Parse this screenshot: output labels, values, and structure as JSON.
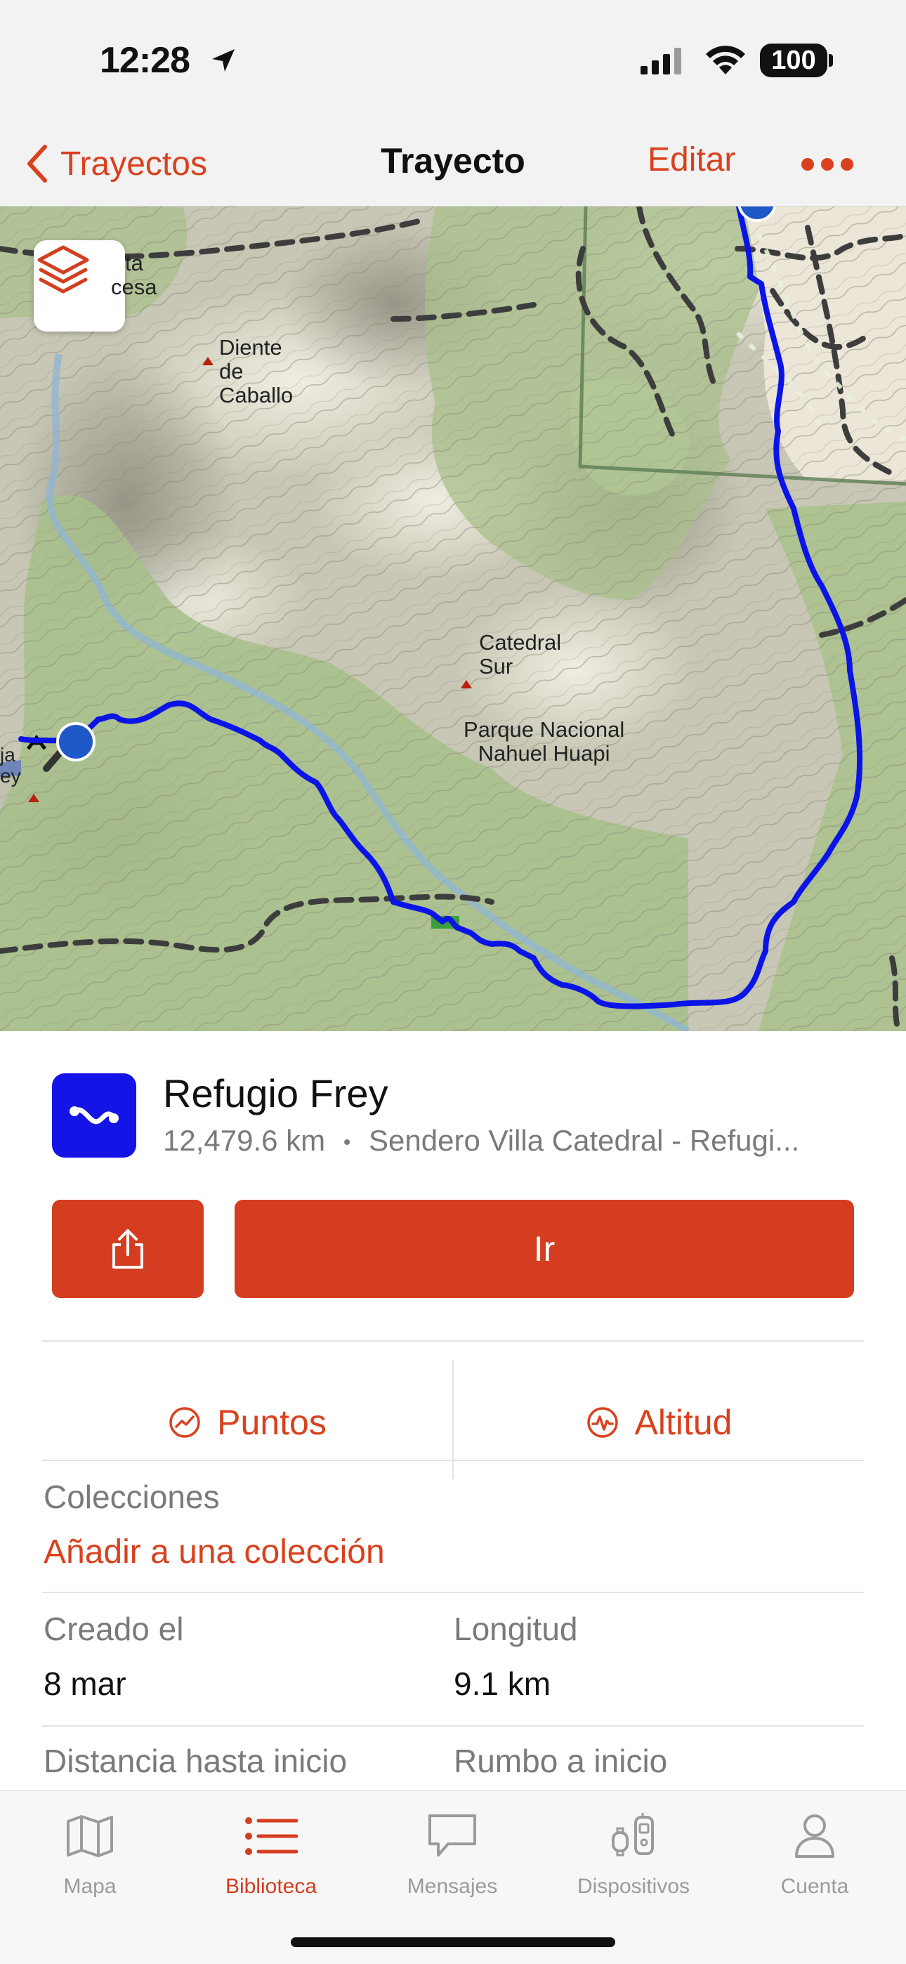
{
  "status": {
    "time": "12:28",
    "battery": "100"
  },
  "nav": {
    "back_label": "Trayectos",
    "title": "Trayecto",
    "edit_label": "Editar"
  },
  "map": {
    "labels": {
      "princesa_a": "ta",
      "princesa_b": "cesa",
      "diente_1": "Diente",
      "diente_2": "de",
      "diente_3": "Caballo",
      "catedral_1": "Catedral",
      "catedral_2": "Sur",
      "parque_1": "Parque Nacional",
      "parque_2": "Nahuel Huapi",
      "frey_a": "ja",
      "frey_b": "ey"
    },
    "colors": {
      "route": "#0a14e6",
      "forest": "#a7c08a",
      "terrain": "#c9c7b6",
      "trail": "#444444"
    }
  },
  "route": {
    "name": "Refugio Frey",
    "distance": "12,479.6 km",
    "separator": "•",
    "subtitle": "Sendero Villa Catedral - Refugi...",
    "go_label": "Ir",
    "points_label": "Puntos",
    "altitude_label": "Altitud"
  },
  "details": {
    "collections_label": "Colecciones",
    "add_collection": "Añadir a una colección",
    "created_label": "Creado el",
    "created_value": "8 mar",
    "length_label": "Longitud",
    "length_value": "9.1 km",
    "distance_start_label": "Distancia hasta inicio",
    "bearing_start_label": "Rumbo a inicio"
  },
  "tabbar": {
    "items": [
      {
        "label": "Mapa",
        "icon": "map-icon"
      },
      {
        "label": "Biblioteca",
        "icon": "list-icon"
      },
      {
        "label": "Mensajes",
        "icon": "message-icon"
      },
      {
        "label": "Dispositivos",
        "icon": "devices-icon"
      },
      {
        "label": "Cuenta",
        "icon": "person-icon"
      }
    ],
    "active": "Biblioteca",
    "accent": "#d43d1f"
  }
}
